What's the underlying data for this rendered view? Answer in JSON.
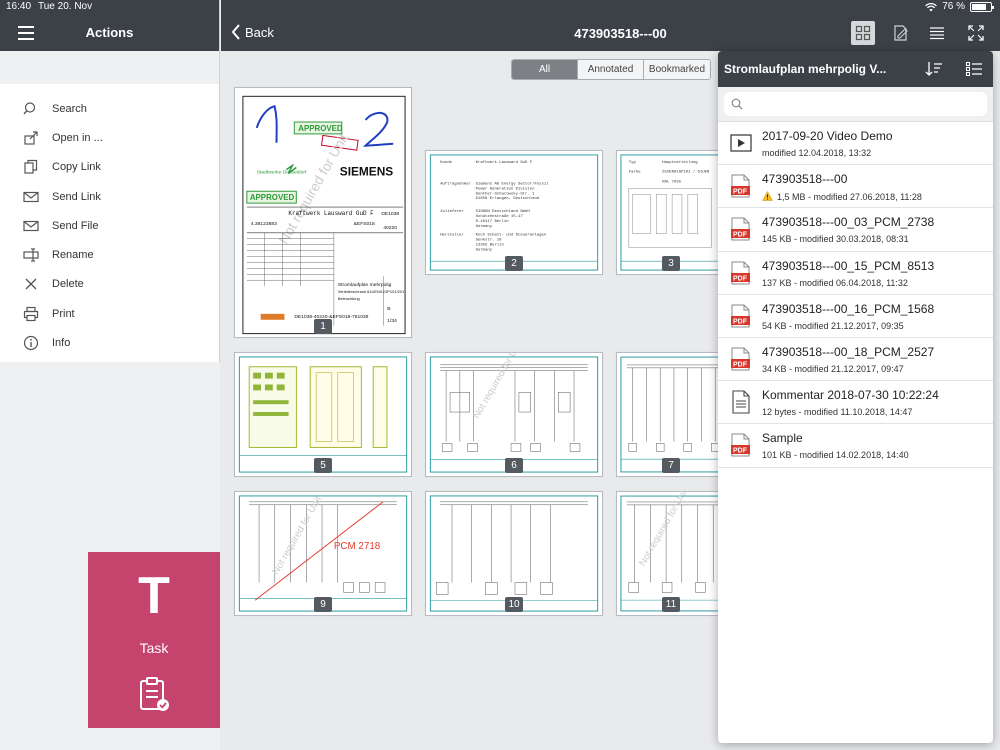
{
  "status_bar": {
    "time": "16:40",
    "date": "Tue 20. Nov",
    "battery": "76 %",
    "battery_level": 0.76
  },
  "sidebar": {
    "title": "Actions",
    "items": [
      {
        "label": "Search",
        "icon": "search-icon"
      },
      {
        "label": "Open in ...",
        "icon": "open-in-icon"
      },
      {
        "label": "Copy Link",
        "icon": "copy-icon"
      },
      {
        "label": "Send Link",
        "icon": "mail-icon"
      },
      {
        "label": "Send File",
        "icon": "mail-file-icon"
      },
      {
        "label": "Rename",
        "icon": "rename-icon"
      },
      {
        "label": "Delete",
        "icon": "close-icon"
      },
      {
        "label": "Print",
        "icon": "printer-icon"
      },
      {
        "label": "Info",
        "icon": "info-icon"
      }
    ]
  },
  "task_tile": {
    "letter": "T",
    "label": "Task",
    "color": "#c4446e"
  },
  "header": {
    "back_label": "Back",
    "title": "473903518---00"
  },
  "filters": {
    "options": [
      "All",
      "Annotated",
      "Bookmarked"
    ],
    "selected": "All"
  },
  "thumbnails": {
    "pages": [
      "1",
      "2",
      "3",
      "5",
      "6",
      "7",
      "9",
      "10",
      "11"
    ],
    "page1": {
      "approved": "APPROVED",
      "brand": "SIEMENS",
      "customer": "Kraftwerk Lausward GuD F",
      "number": "4.38123883",
      "code1": "DE1038",
      "code2": "&EFS018",
      "code3": "40220",
      "desc1": "Stromlaufplan mehrpolig",
      "desc2": "Verteilerschrank 61UEN01GP101/201",
      "desc3": "Beleuchtung",
      "footer": "DE1038-40220-&EFS018-781039",
      "rev": "B",
      "sheet": "1/34",
      "stamp": "Stadtwerke Düsseldorf"
    },
    "page2": {
      "l1": "Kunde",
      "v1": "Kraftwerk Lausward GuD F",
      "l2": "Auftragnehmer",
      "v2a": "Siemens AG Energy Sector/Fossil",
      "v2b": "Power Generation Division",
      "v2c": "Günther-Scharowsky-Str. 1",
      "v2d": "91058 Erlangen, Deutschland",
      "l3": "Zulieferer",
      "v3a": "SIGNON Deutschland GmbH",
      "v3b": "Schützenstraße 15-17",
      "v3c": "D-10117 Berlin",
      "v3d": "Germany",
      "l4": "Hersteller",
      "v4a": "Koch Schalt- und Steueranlagen",
      "v4b": "Senkstr. 10",
      "v4c": "13355 Berlin",
      "v4d": "Germany"
    },
    "page3": {
      "l1": "Typ",
      "v1": "Hauptverteilung",
      "l2": "Farbe",
      "v2": "RAL 7035",
      "code": "61UEN01GP101 / 61UEN"
    },
    "page9_annotation": "PCM 2718",
    "accent_green": "#2f9a3c",
    "annotation_blue": "#1f3fbf",
    "annotation_red": "#e53c2b"
  },
  "popover": {
    "title": "Stromlaufplan mehrpolig V...",
    "search_placeholder": "",
    "files": [
      {
        "name": "2017-09-20 Video Demo",
        "meta": "modified 12.04.2018, 13:32",
        "icon": "video-icon",
        "warning": false
      },
      {
        "name": "473903518---00",
        "meta": "1,5 MB - modified 27.06.2018, 11:28",
        "icon": "pdf-icon",
        "warning": true
      },
      {
        "name": "473903518---00_03_PCM_2738",
        "meta": "145 KB - modified 30.03.2018, 08:31",
        "icon": "pdf-icon",
        "warning": false
      },
      {
        "name": "473903518---00_15_PCM_8513",
        "meta": "137 KB - modified 06.04.2018, 11:32",
        "icon": "pdf-icon",
        "warning": false
      },
      {
        "name": "473903518---00_16_PCM_1568",
        "meta": "54 KB - modified 21.12.2017, 09:35",
        "icon": "pdf-icon",
        "warning": false
      },
      {
        "name": "473903518---00_18_PCM_2527",
        "meta": "34 KB - modified 21.12.2017, 09:47",
        "icon": "pdf-icon",
        "warning": false
      },
      {
        "name": "Kommentar 2018-07-30 10:22:24",
        "meta": "12 bytes - modified 11.10.2018, 14:47",
        "icon": "text-file-icon",
        "warning": false
      },
      {
        "name": "Sample",
        "meta": "101 KB - modified 14.02.2018, 14:40",
        "icon": "pdf-icon",
        "warning": false
      }
    ]
  },
  "colors": {
    "header": "#3c4147",
    "task": "#c4446e",
    "pdf_red": "#d9352a"
  }
}
